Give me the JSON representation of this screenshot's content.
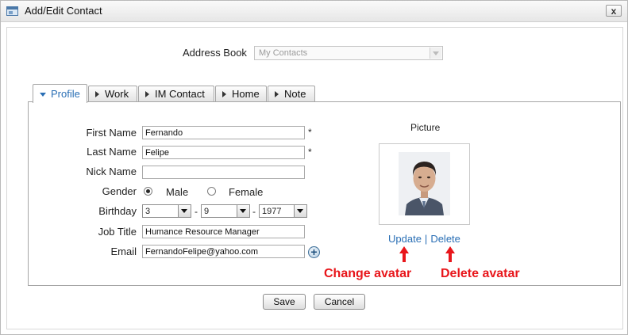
{
  "window": {
    "title": "Add/Edit Contact",
    "close_label": "x"
  },
  "address_book": {
    "label": "Address Book",
    "selected": "My Contacts"
  },
  "tabs": [
    {
      "label": "Profile",
      "active": true
    },
    {
      "label": "Work",
      "active": false
    },
    {
      "label": "IM Contact",
      "active": false
    },
    {
      "label": "Home",
      "active": false
    },
    {
      "label": "Note",
      "active": false
    }
  ],
  "form": {
    "first_name": {
      "label": "First Name",
      "value": "Fernando",
      "required_mark": "*"
    },
    "last_name": {
      "label": "Last Name",
      "value": "Felipe",
      "required_mark": "*"
    },
    "nick_name": {
      "label": "Nick Name",
      "value": ""
    },
    "gender": {
      "label": "Gender",
      "options": [
        "Male",
        "Female"
      ],
      "selected": "Male"
    },
    "birthday": {
      "label": "Birthday",
      "day": "3",
      "month": "9",
      "year": "1977",
      "separator": "-"
    },
    "job_title": {
      "label": "Job Title",
      "value": "Humance Resource Manager"
    },
    "email": {
      "label": "Email",
      "value": "FernandoFelipe@yahoo.com",
      "add_icon": "plus-circle-icon"
    }
  },
  "picture": {
    "label": "Picture",
    "update_link": "Update",
    "separator": "|",
    "delete_link": "Delete",
    "annotation_change": "Change avatar",
    "annotation_delete": "Delete avatar",
    "annotation_color": "#e8161b"
  },
  "buttons": {
    "save": "Save",
    "cancel": "Cancel"
  },
  "colors": {
    "link": "#2a6fb5",
    "active_tab": "#2a6fb5"
  }
}
